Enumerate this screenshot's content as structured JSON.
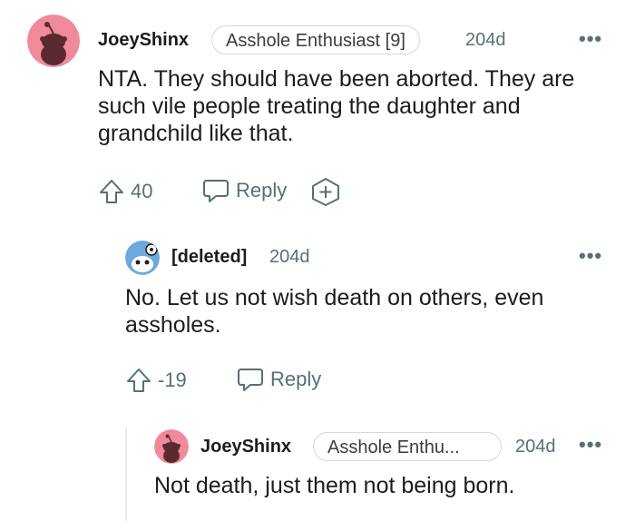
{
  "comments": [
    {
      "username": "JoeyShinx",
      "flair": "Asshole Enthusiast [9]",
      "age": "204d",
      "body": "NTA. They should have been aborted. They are such vile people treating the daughter and grandchild like that.",
      "score": "40",
      "reply_label": "Reply",
      "avatar_icon": "snoo-avatar-icon"
    },
    {
      "username": "[deleted]",
      "age": "204d",
      "body": "No. Let us not wish death on others, even assholes.",
      "score": "-19",
      "reply_label": "Reply",
      "avatar_icon": "deleted-avatar-icon"
    },
    {
      "username": "JoeyShinx",
      "flair": "Asshole Enthu...",
      "age": "204d",
      "body": "Not death, just them not being born.",
      "avatar_icon": "snoo-avatar-icon"
    }
  ],
  "more_options": "•••",
  "colors": {
    "avatar_pink": "#f08a9a",
    "avatar_dark": "#5a2a30",
    "muted": "#576f76"
  }
}
